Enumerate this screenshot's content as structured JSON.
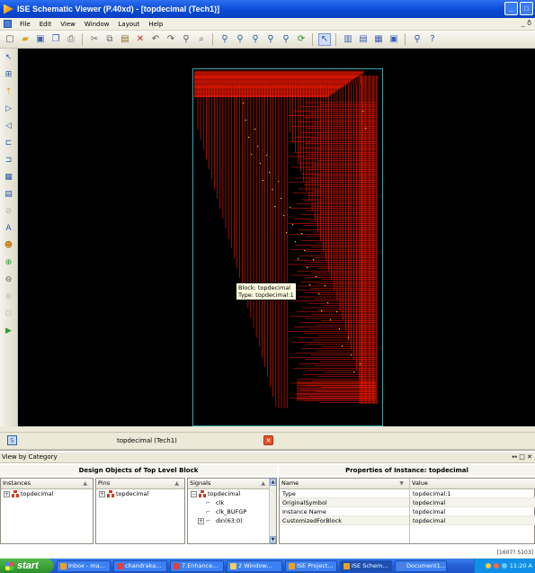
{
  "window": {
    "title": "ISE Schematic Viewer (P.40xd) - [topdecimal (Tech1)]"
  },
  "menu": {
    "items": [
      "File",
      "Edit",
      "View",
      "Window",
      "Layout",
      "Help"
    ]
  },
  "canvas": {
    "tooltip": {
      "line1": "Block: topdecimal",
      "line2": "Type: topdecimal:1"
    },
    "colors": {
      "background": "#000000",
      "wires": "#ff1a00",
      "block_border": "#3fa0a8"
    }
  },
  "tab": {
    "label": "topdecimal (Tech1)"
  },
  "panel": {
    "title": "View by Category",
    "controls": "↔ □ ✕",
    "design_header": "Design Objects of Top Level Block",
    "props_header": "Properties of Instance: topdecimal",
    "instances": {
      "header": "Instances",
      "items": [
        "topdecimal"
      ]
    },
    "pins": {
      "header": "Pins",
      "items": [
        "topdecimal"
      ]
    },
    "signals": {
      "header": "Signals",
      "root": "topdecimal",
      "children": [
        "clk",
        "clk_BUFGP",
        "din(63:0)"
      ]
    },
    "properties": {
      "name_header": "Name",
      "value_header": "Value",
      "rows": [
        {
          "name": "Type",
          "value": "topdecimal:1"
        },
        {
          "name": "OriginalSymbol",
          "value": "topdecimal"
        },
        {
          "name": "Instance Name",
          "value": "topdecimal"
        },
        {
          "name": "CustomizedForBlock",
          "value": "topdecimal"
        }
      ]
    }
  },
  "status": {
    "coords": "[1607? 5103]"
  },
  "taskbar": {
    "start": "start",
    "tasks": [
      "Inbox - ma...",
      "chandraka...",
      "7.Enhance...",
      "2 Window...",
      "ISE Project...",
      "ISE Schem...",
      "Document1..."
    ],
    "clock": "11:20 A"
  }
}
